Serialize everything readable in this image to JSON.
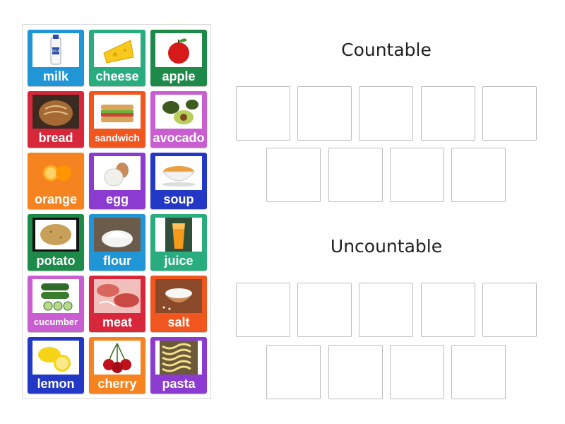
{
  "groups": {
    "countable_title": "Countable",
    "uncountable_title": "Uncountable"
  },
  "cards": [
    {
      "label": "milk",
      "color": "#2196d6",
      "icon": "milk-bottle-icon"
    },
    {
      "label": "cheese",
      "color": "#2aad7e",
      "icon": "cheese-icon"
    },
    {
      "label": "apple",
      "color": "#1e8a4a",
      "icon": "apple-icon"
    },
    {
      "label": "bread",
      "color": "#d8273b",
      "icon": "bread-icon"
    },
    {
      "label": "sandwich",
      "color": "#f0561d",
      "icon": "sandwich-icon"
    },
    {
      "label": "avocado",
      "color": "#c95ed1",
      "icon": "avocado-icon"
    },
    {
      "label": "orange",
      "color": "#f5831f",
      "icon": "orange-icon"
    },
    {
      "label": "egg",
      "color": "#8c3bd1",
      "icon": "egg-icon"
    },
    {
      "label": "soup",
      "color": "#2338c4",
      "icon": "soup-icon"
    },
    {
      "label": "potato",
      "color": "#1e8a4a",
      "icon": "potato-icon"
    },
    {
      "label": "flour",
      "color": "#2196d6",
      "icon": "flour-icon"
    },
    {
      "label": "juice",
      "color": "#2aad7e",
      "icon": "juice-icon"
    },
    {
      "label": "cucumber",
      "color": "#c95ed1",
      "icon": "cucumber-icon"
    },
    {
      "label": "meat",
      "color": "#d8273b",
      "icon": "meat-icon"
    },
    {
      "label": "salt",
      "color": "#f0561d",
      "icon": "salt-icon"
    },
    {
      "label": "lemon",
      "color": "#2338c4",
      "icon": "lemon-icon"
    },
    {
      "label": "cherry",
      "color": "#f5831f",
      "icon": "cherry-icon"
    },
    {
      "label": "pasta",
      "color": "#8c3bd1",
      "icon": "pasta-icon"
    }
  ]
}
